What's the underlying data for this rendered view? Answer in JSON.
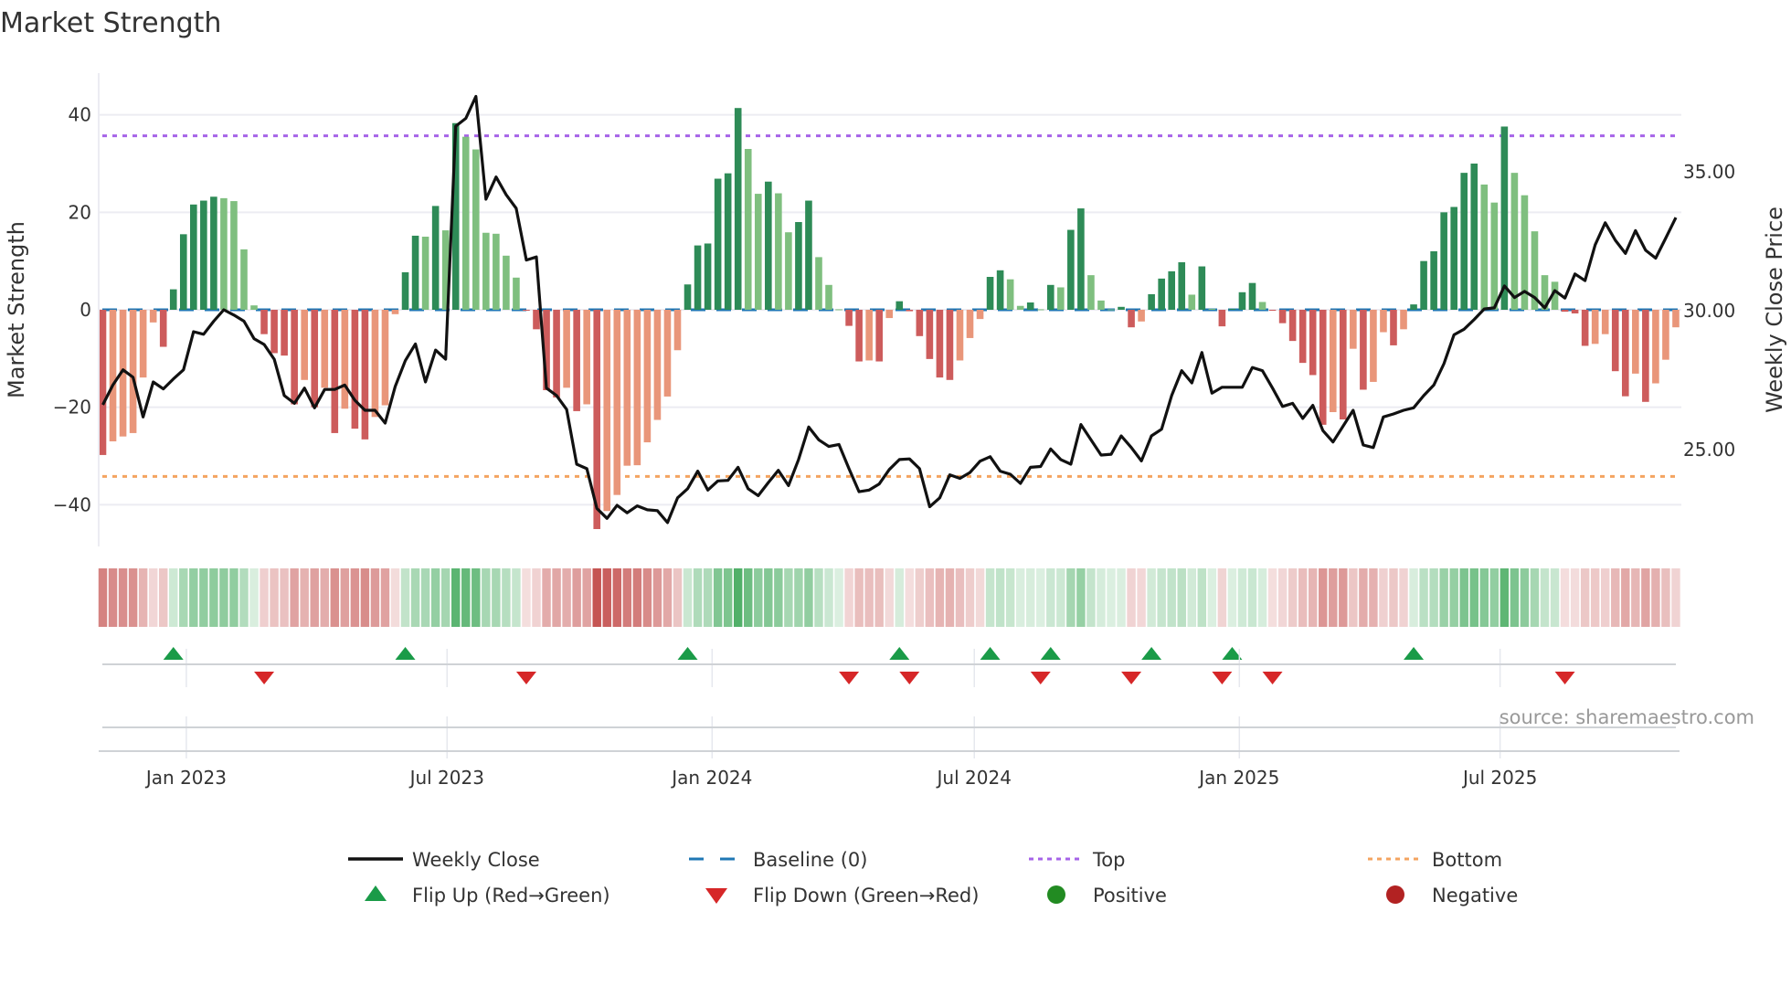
{
  "title": "Market Strength",
  "source": "source: sharemaestro.com",
  "colors": {
    "pos_up": "#2e8b57",
    "pos_down": "#7fbf7f",
    "neg_down": "#cd5c5c",
    "neg_up": "#e9967a",
    "close": "#111111",
    "baseline": "#1f77b4",
    "top": "#a663e8",
    "bottom": "#f4a460",
    "flip_up": "#1a9b48",
    "flip_down": "#d62728",
    "heat_pos": "#3aa655",
    "heat_neg": "#c24a48",
    "legend_positive": "#228b22",
    "legend_negative": "#b22222"
  },
  "chart_data": {
    "type": "bar+line",
    "title": "Market Strength",
    "ylabel": "Market Strength",
    "y2label": "Weekly Close Price",
    "ylim": [
      -49,
      49
    ],
    "y2lim": [
      21.4,
      38.6
    ],
    "yticks": [
      "40",
      "20",
      "0",
      "−40",
      "−20"
    ],
    "ytick_values": [
      40,
      20,
      0,
      -40,
      -20
    ],
    "y2ticks": [
      "35.00",
      "30.00",
      "25.00"
    ],
    "y2tick_values": [
      35,
      30,
      25
    ],
    "x_start": "2022-11-04",
    "x_step_days": 7,
    "xticks": [
      {
        "label": "Jan 2023",
        "date": "2023-01-01"
      },
      {
        "label": "Jul 2023",
        "date": "2023-07-01"
      },
      {
        "label": "Jan 2024",
        "date": "2024-01-01"
      },
      {
        "label": "Jul 2024",
        "date": "2024-07-01"
      },
      {
        "label": "Jan 2025",
        "date": "2025-01-01"
      },
      {
        "label": "Jul 2025",
        "date": "2025-07-01"
      }
    ],
    "top_level": 35.7,
    "bottom_level": -34.2,
    "baseline": 0,
    "strength": [
      -29.8,
      -27,
      -26,
      -25.3,
      -13.9,
      -2.6,
      -7.6,
      4.2,
      15.5,
      21.6,
      22.4,
      23.2,
      22.9,
      22.3,
      12.4,
      0.9,
      -5,
      -8.9,
      -9.4,
      -19.4,
      -14.4,
      -20,
      -16,
      -25.3,
      -20.3,
      -24.4,
      -26.6,
      -22,
      -19.6,
      -0.9,
      7.7,
      15.2,
      15,
      21.3,
      16.3,
      38.3,
      35.5,
      32.9,
      15.8,
      15.6,
      11.1,
      6.6,
      -0.2,
      -4,
      -16.5,
      -18,
      -16,
      -20.8,
      -19.4,
      -45,
      -41.3,
      -38,
      -32,
      -31.9,
      -27.2,
      -22.6,
      -17.8,
      -8.3,
      5.2,
      13.2,
      13.6,
      26.9,
      28,
      41.4,
      33,
      23.8,
      26.3,
      23.9,
      15.9,
      18,
      22.4,
      10.8,
      5.1,
      0.1,
      -3.3,
      -10.6,
      -10.4,
      -10.6,
      -1.7,
      1.75,
      -0.3,
      -5.4,
      -10.1,
      -13.9,
      -14.4,
      -10.4,
      -5.8,
      -1.9,
      6.75,
      8.1,
      6.25,
      0.8,
      1.5,
      0.1,
      5.1,
      4.6,
      16.4,
      20.8,
      7.1,
      1.9,
      0.1,
      0.6,
      -3.6,
      -2.4,
      3.2,
      6.4,
      7.9,
      9.75,
      3.1,
      8.9,
      0.2,
      -3.4,
      0.2,
      3.6,
      5.5,
      1.6,
      -0.2,
      -2.75,
      -6.4,
      -10.9,
      -13.4,
      -23.6,
      -21,
      -22.5,
      -8,
      -16.4,
      -14.8,
      -4.6,
      -7.3,
      -4,
      1.1,
      10,
      12,
      20,
      21.1,
      28.1,
      30,
      25.7,
      22,
      37.6,
      28.1,
      23.5,
      16.1,
      7.1,
      5.75,
      -0.4,
      -0.75,
      -7.4,
      -7,
      -5,
      -12.6,
      -17.75,
      -13.1,
      -18.9,
      -15.1,
      -10.25,
      -3.6
    ],
    "close": [
      26.58,
      27.29,
      27.84,
      27.57,
      26.14,
      27.4,
      27.15,
      27.51,
      27.84,
      29.21,
      29.12,
      29.59,
      30.0,
      29.81,
      29.59,
      28.96,
      28.75,
      28.22,
      26.91,
      26.63,
      27.18,
      26.47,
      27.13,
      27.13,
      27.29,
      26.74,
      26.38,
      26.38,
      25.92,
      27.24,
      28.17,
      28.77,
      27.4,
      28.55,
      28.22,
      36.61,
      36.89,
      37.68,
      33.98,
      34.78,
      34.14,
      33.65,
      31.79,
      31.9,
      27.18,
      26.91,
      26.41,
      24.44,
      24.28,
      22.85,
      22.49,
      22.96,
      22.69,
      22.94,
      22.8,
      22.77,
      22.34,
      23.23,
      23.56,
      24.19,
      23.51,
      23.84,
      23.86,
      24.33,
      23.56,
      23.31,
      23.78,
      24.22,
      23.67,
      24.61,
      25.78,
      25.32,
      25.08,
      25.15,
      24.28,
      23.45,
      23.51,
      23.73,
      24.25,
      24.61,
      24.63,
      24.28,
      22.91,
      23.23,
      24.06,
      23.93,
      24.14,
      24.55,
      24.71,
      24.19,
      24.08,
      23.75,
      24.33,
      24.36,
      24.99,
      24.61,
      24.44,
      25.87,
      25.32,
      24.77,
      24.8,
      25.46,
      25.04,
      24.56,
      25.46,
      25.7,
      26.91,
      27.81,
      27.37,
      28.46,
      27.0,
      27.21,
      27.21,
      27.21,
      27.92,
      27.81,
      27.18,
      26.52,
      26.63,
      26.09,
      26.56,
      25.65,
      25.24,
      25.81,
      26.38,
      25.13,
      25.04,
      26.14,
      26.25,
      26.38,
      26.47,
      26.91,
      27.29,
      28.06,
      29.1,
      29.3,
      29.65,
      30.03,
      30.07,
      30.86,
      30.44,
      30.66,
      30.44,
      30.07,
      30.69,
      30.42,
      31.29,
      31.05,
      32.34,
      33.13,
      32.5,
      32.03,
      32.85,
      32.14,
      31.86,
      32.58,
      33.32
    ],
    "flip_up_weeks": [
      7,
      30,
      58,
      79,
      88,
      94,
      104,
      112,
      130
    ],
    "flip_down_weeks": [
      16,
      42,
      74,
      80,
      93,
      102,
      111,
      116,
      145
    ],
    "legend": {
      "placement": "bottom",
      "items": [
        {
          "label": "Weekly Close",
          "symbol": "line"
        },
        {
          "label": "Baseline (0)",
          "symbol": "dash"
        },
        {
          "label": "Top",
          "symbol": "dot-top"
        },
        {
          "label": "Bottom",
          "symbol": "dot-bottom"
        },
        {
          "label": "Flip Up (Red→Green)",
          "symbol": "tri-up"
        },
        {
          "label": "Flip Down (Green→Red)",
          "symbol": "tri-down"
        },
        {
          "label": "Positive",
          "symbol": "circle-pos"
        },
        {
          "label": "Negative",
          "symbol": "circle-neg"
        }
      ]
    }
  }
}
